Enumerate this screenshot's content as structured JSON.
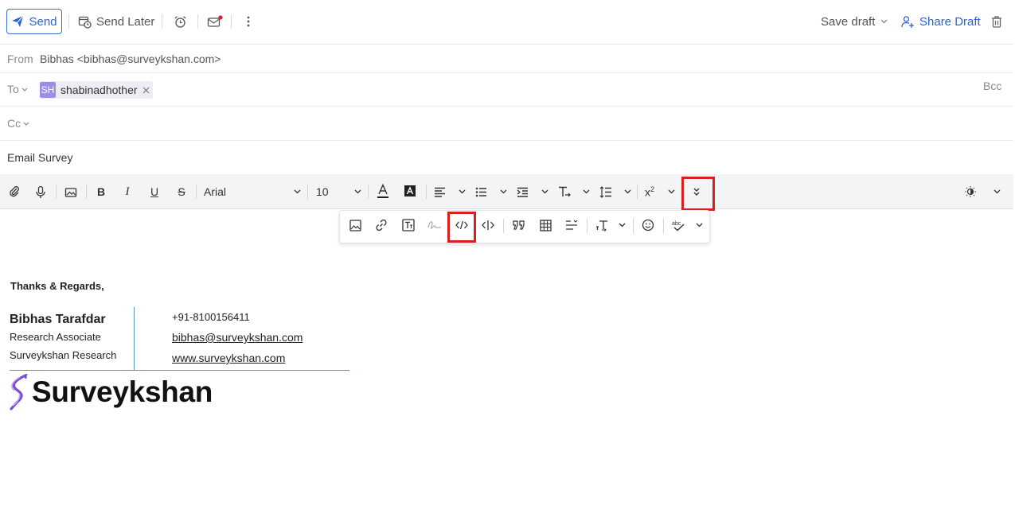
{
  "toolbar": {
    "send_label": "Send",
    "send_later_label": "Send Later",
    "save_draft_label": "Save draft",
    "share_draft_label": "Share Draft"
  },
  "from": {
    "label": "From",
    "value": "Bibhas <bibhas@surveykshan.com>"
  },
  "to": {
    "label": "To",
    "chip_initials": "SH",
    "chip_name": "shabinadhother",
    "bcc_label": "Bcc"
  },
  "cc": {
    "label": "Cc"
  },
  "subject": {
    "value": "Email Survey"
  },
  "format": {
    "font_family": "Arial",
    "font_size": "10"
  },
  "signature": {
    "greeting": "Thanks & Regards,",
    "name": "Bibhas Tarafdar",
    "title": "Research Associate",
    "company": "Surveykshan Research",
    "phone": "+91-8100156411",
    "email": "bibhas@surveykshan.com",
    "website": "www.surveykshan.com",
    "logo_text": "Surveykshan"
  },
  "colors": {
    "accent": "#2b62d6",
    "highlight": "#d8201f",
    "chip_avatar": "#9a8fe8",
    "logo_primary": "#7b4dd9"
  }
}
